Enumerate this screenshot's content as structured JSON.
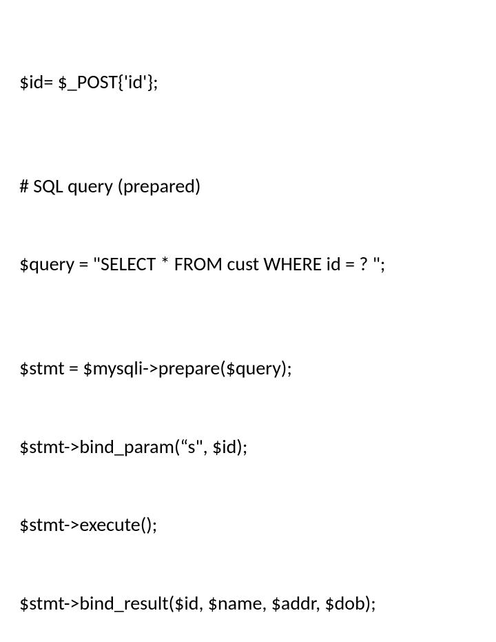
{
  "code": {
    "line1": "$id= $_POST{'id'};",
    "line2": "# SQL query (prepared)",
    "line3": "$query = \"SELECT * FROM cust WHERE id = ? \";",
    "line4": "$stmt = $mysqli->prepare($query);",
    "line5": "$stmt->bind_param(“s\", $id);",
    "line6": "$stmt->execute();",
    "line7": "$stmt->bind_result($id, $name, $addr, $dob);"
  }
}
